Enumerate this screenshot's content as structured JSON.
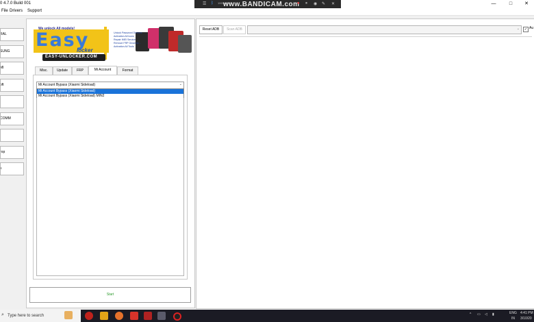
{
  "window": {
    "title": "0 4.7.0 Build 001",
    "controls": {
      "minimize": "—",
      "maximize": "□",
      "close": "✕"
    }
  },
  "menu": [
    "File",
    "Drivers",
    "Support"
  ],
  "recorder": {
    "resolution": "1920x1080",
    "logo": "www.BANDICAM.com"
  },
  "left_buttons": [
    "RAL",
    "SUNG",
    "MI",
    "oft",
    "",
    "COMM",
    "",
    "rop",
    "k"
  ],
  "banner": {
    "tagline": "We unlock All models!",
    "brand_top": "Easy",
    "brand_sub": "locker",
    "url": "EASY-UNLOCKER.COM",
    "features": [
      "Unlock Password Devices",
      "Activation All Icons",
      "Repair IMEI Service",
      "Remove FRP Gmail Ac...",
      "Activation All Tools"
    ]
  },
  "tabs": [
    {
      "label": "Misc.",
      "active": false
    },
    {
      "label": "Update",
      "active": false
    },
    {
      "label": "FRP",
      "active": false
    },
    {
      "label": "Mi Account",
      "active": true
    },
    {
      "label": "Format",
      "active": false
    }
  ],
  "mi_account": {
    "selected": "Mi Account Bypass  (Xiaomi Sideload)",
    "options": [
      "Mi Account Bypass  (Xiaomi Sideload)",
      "Mi Account Bypass  (Xiaomi Sideload) MIN2"
    ]
  },
  "start_label": "Start",
  "adb": {
    "reset_label": "Reset ADB",
    "scan_label": "Scan ADB",
    "auto_label": "Au",
    "auto_checked": true
  },
  "taskbar": {
    "search_placeholder": "Type here to search",
    "lang": "ENG",
    "region": "IN",
    "time": "4:41 PM",
    "date": "3/10/20"
  }
}
